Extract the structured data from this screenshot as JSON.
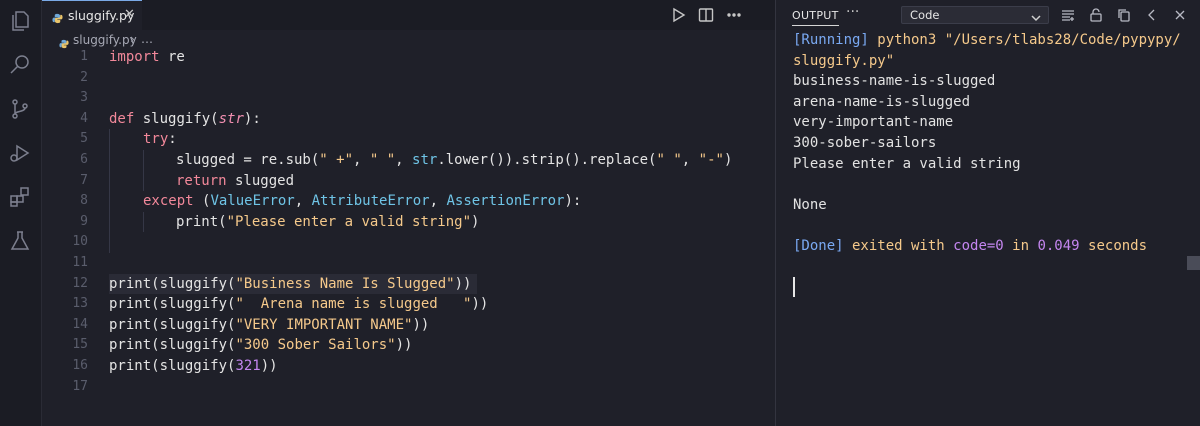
{
  "activity_bar": {
    "icons": [
      "files-icon",
      "search-icon",
      "source-control-icon",
      "run-debug-icon",
      "extensions-icon",
      "testing-icon"
    ]
  },
  "editor": {
    "tab": {
      "label": "sluggify.py",
      "close": "✕"
    },
    "breadcrumb": {
      "file": "sluggify.py",
      "separator": "›",
      "more": "…"
    },
    "actions": [
      "run-icon",
      "split-editor-icon",
      "more-actions-icon"
    ],
    "line_numbers": [
      "1",
      "2",
      "3",
      "4",
      "5",
      "6",
      "7",
      "8",
      "9",
      "10",
      "11",
      "12",
      "13",
      "14",
      "15",
      "16",
      "17"
    ],
    "code": {
      "l1_kw": "import",
      "l1_rest": " re",
      "l4_kw": "def",
      "l4_fn": " sluggify(",
      "l4_par": "str",
      "l4_end": "):",
      "l5_kw": "try",
      "l5_end": ":",
      "l6_a": "slugged = re.sub(",
      "l6_s1": "\" +\"",
      "l6_b": ", ",
      "l6_s2": "\" \"",
      "l6_c": ", ",
      "l6_cls": "str",
      "l6_d": ".lower()).strip().replace(",
      "l6_s3": "\" \"",
      "l6_e": ", ",
      "l6_s4": "\"-\"",
      "l6_f": ")",
      "l7_kw": "return",
      "l7_rest": " slugged",
      "l8_kw": "except",
      "l8_a": " (",
      "l8_c1": "ValueError",
      "l8_b": ", ",
      "l8_c2": "AttributeError",
      "l8_c": ", ",
      "l8_c3": "AssertionError",
      "l8_d": "):",
      "l9_a": "print(",
      "l9_s": "\"Please enter a valid string\"",
      "l9_b": ")",
      "l12_a": "print(sluggify(",
      "l12_s": "\"Business Name Is Slugged\"",
      "l12_b": "))",
      "l13_a": "print(sluggify(",
      "l13_s": "\"  Arena name is slugged   \"",
      "l13_b": "))",
      "l14_a": "print(sluggify(",
      "l14_s": "\"VERY IMPORTANT NAME\"",
      "l14_b": "))",
      "l15_a": "print(sluggify(",
      "l15_s": "\"300 Sober Sailors\"",
      "l15_b": "))",
      "l16_a": "print(sluggify(",
      "l16_n": "321",
      "l16_b": "))"
    }
  },
  "output_panel": {
    "title": "OUTPUT",
    "more": "···",
    "channel": "Code",
    "actions": [
      "filter-list-icon",
      "lock-icon",
      "copy-icon",
      "back-icon",
      "close-icon"
    ],
    "lines": {
      "r1_tag": "[Running]",
      "r1_cmd": " python3 \"/Users/tlabs28/Code/pypypy/",
      "r2": "sluggify.py\"",
      "o1": "business-name-is-slugged",
      "o2": "arena-name-is-slugged",
      "o3": "very-important-name",
      "o4": "300-sober-sailors",
      "o5": "Please enter a valid string",
      "o6": "None",
      "d_tag": "[Done]",
      "d_a": " exited with ",
      "d_code": "code=0",
      "d_b": " in ",
      "d_time": "0.049",
      "d_c": " seconds"
    }
  }
}
